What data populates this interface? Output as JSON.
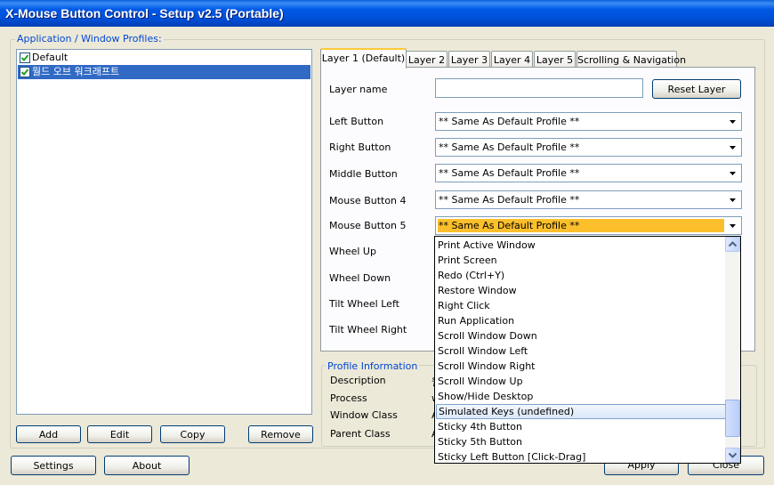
{
  "window": {
    "title": "X-Mouse Button Control - Setup v2.5 (Portable)"
  },
  "profiles": {
    "group_title": "Application / Window Profiles:",
    "items": [
      {
        "label": "Default",
        "checked": true,
        "selected": false
      },
      {
        "label": "월드 오브 워크래프트",
        "checked": true,
        "selected": true
      }
    ],
    "buttons": {
      "add": "Add",
      "edit": "Edit",
      "copy": "Copy",
      "remove": "Remove"
    }
  },
  "bottom_buttons": {
    "settings": "Settings",
    "about": "About",
    "apply": "Apply",
    "close": "Close"
  },
  "tabs": [
    "Layer 1 (Default)",
    "Layer 2",
    "Layer 3",
    "Layer 4",
    "Layer 5",
    "Scrolling & Navigation"
  ],
  "layer": {
    "layer_name_label": "Layer name",
    "layer_name_value": "",
    "reset_button": "Reset Layer",
    "rows": [
      {
        "label": "Left Button",
        "value": "** Same As Default Profile **"
      },
      {
        "label": "Right Button",
        "value": "** Same As Default Profile **"
      },
      {
        "label": "Middle Button",
        "value": "** Same As Default Profile **"
      },
      {
        "label": "Mouse Button 4",
        "value": "** Same As Default Profile **"
      },
      {
        "label": "Mouse Button 5",
        "value": "** Same As Default Profile **"
      },
      {
        "label": "Wheel Up"
      },
      {
        "label": "Wheel Down"
      },
      {
        "label": "Tilt Wheel Left"
      },
      {
        "label": "Tilt Wheel Right"
      }
    ]
  },
  "dropdown": {
    "items": [
      "Print Active Window",
      "Print Screen",
      "Redo (Ctrl+Y)",
      "Restore Window",
      "Right Click",
      "Run Application",
      "Scroll Window Down",
      "Scroll Window Left",
      "Scroll Window Right",
      "Scroll Window Up",
      "Show/Hide Desktop",
      "Simulated Keys (undefined)",
      "Sticky 4th Button",
      "Sticky 5th Button",
      "Sticky Left Button [Click-Drag]"
    ],
    "hovered_index": 11
  },
  "profile_info": {
    "group_title": "Profile Information",
    "labels": [
      "Description",
      "Process",
      "Window Class",
      "Parent Class"
    ],
    "values_partial": [
      "월",
      "w",
      "A",
      "A"
    ]
  },
  "colors": {
    "title_bar": "#0054e3",
    "selection": "#316ac5",
    "focus_highlight": "#fcbf2c",
    "group_title": "#0046d5"
  }
}
